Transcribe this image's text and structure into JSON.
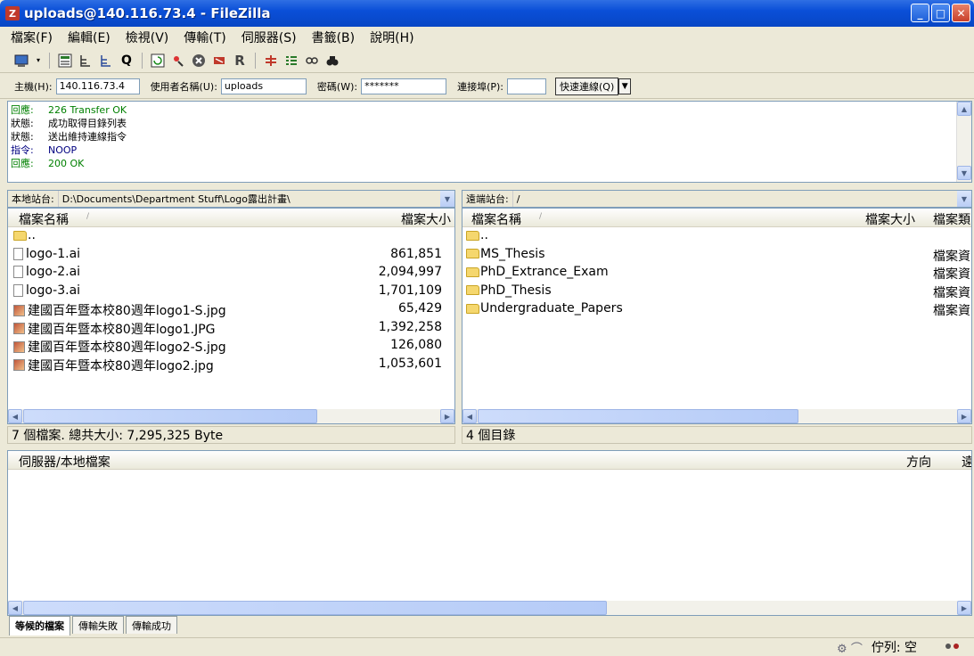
{
  "window": {
    "title": "uploads@140.116.73.4 - FileZilla",
    "app_icon": "Z",
    "min_label": "_",
    "max_label": "□",
    "close_label": "✕"
  },
  "menu": [
    "檔案(F)",
    "編輯(E)",
    "檢視(V)",
    "傳輸(T)",
    "伺服器(S)",
    "書籤(B)",
    "說明(H)"
  ],
  "toolbar_icons": [
    "site-manager-icon",
    "dropdown-arrow-icon",
    "toggle-log-icon",
    "toggle-local-tree-icon",
    "toggle-remote-tree-icon",
    "toggle-queue-icon",
    "refresh-icon",
    "process-queue-icon",
    "cancel-icon",
    "disconnect-icon",
    "reconnect-icon",
    "compare-icon",
    "filter-icon",
    "sync-browse-icon",
    "search-icon"
  ],
  "quickconnect": {
    "host_label": "主機(H):",
    "host_value": "140.116.73.4",
    "user_label": "使用者名稱(U):",
    "user_value": "uploads",
    "pass_label": "密碼(W):",
    "pass_value": "*******",
    "port_label": "連接埠(P):",
    "port_value": "",
    "button": "快速連線(Q)"
  },
  "log": [
    {
      "label": "回應:",
      "text": "226 Transfer OK",
      "color": "#008000"
    },
    {
      "label": "狀態:",
      "text": "成功取得目錄列表",
      "color": "#000000"
    },
    {
      "label": "狀態:",
      "text": "送出維持連線指令",
      "color": "#000000"
    },
    {
      "label": "指令:",
      "text": "NOOP",
      "color": "#000080"
    },
    {
      "label": "回應:",
      "text": "200 OK",
      "color": "#008000"
    }
  ],
  "local": {
    "path_label": "本地站台:",
    "path": "D:\\Documents\\Department Stuff\\Logo露出計畫\\",
    "col_name": "檔案名稱",
    "col_size": "檔案大小",
    "files": [
      {
        "name": "..",
        "size": "",
        "icon": "folder-icon"
      },
      {
        "name": "logo-1.ai",
        "size": "861,851",
        "icon": "file-icon"
      },
      {
        "name": "logo-2.ai",
        "size": "2,094,997",
        "icon": "file-icon"
      },
      {
        "name": "logo-3.ai",
        "size": "1,701,109",
        "icon": "file-icon"
      },
      {
        "name": "建國百年暨本校80週年logo1-S.jpg",
        "size": "65,429",
        "icon": "image-icon"
      },
      {
        "name": "建國百年暨本校80週年logo1.JPG",
        "size": "1,392,258",
        "icon": "image-icon"
      },
      {
        "name": "建國百年暨本校80週年logo2-S.jpg",
        "size": "126,080",
        "icon": "image-icon"
      },
      {
        "name": "建國百年暨本校80週年logo2.jpg",
        "size": "1,053,601",
        "icon": "image-icon"
      }
    ],
    "status": "7 個檔案. 總共大小: 7,295,325 Byte"
  },
  "remote": {
    "path_label": "遠端站台:",
    "path": "/",
    "col_name": "檔案名稱",
    "col_size": "檔案大小",
    "col_type": "檔案類",
    "files": [
      {
        "name": "..",
        "type": ""
      },
      {
        "name": "MS_Thesis",
        "type": "檔案資"
      },
      {
        "name": "PhD_Extrance_Exam",
        "type": "檔案資"
      },
      {
        "name": "PhD_Thesis",
        "type": "檔案資"
      },
      {
        "name": "Undergraduate_Papers",
        "type": "檔案資"
      }
    ],
    "status": "4 個目錄"
  },
  "queue": {
    "col_file": "伺服器/本地檔案",
    "col_dir": "方向",
    "col_remote": "遠"
  },
  "tabs": [
    "等候的檔案",
    "傳輸失敗",
    "傳輸成功"
  ],
  "statusbar": {
    "queue_text": "佇列: 空"
  }
}
